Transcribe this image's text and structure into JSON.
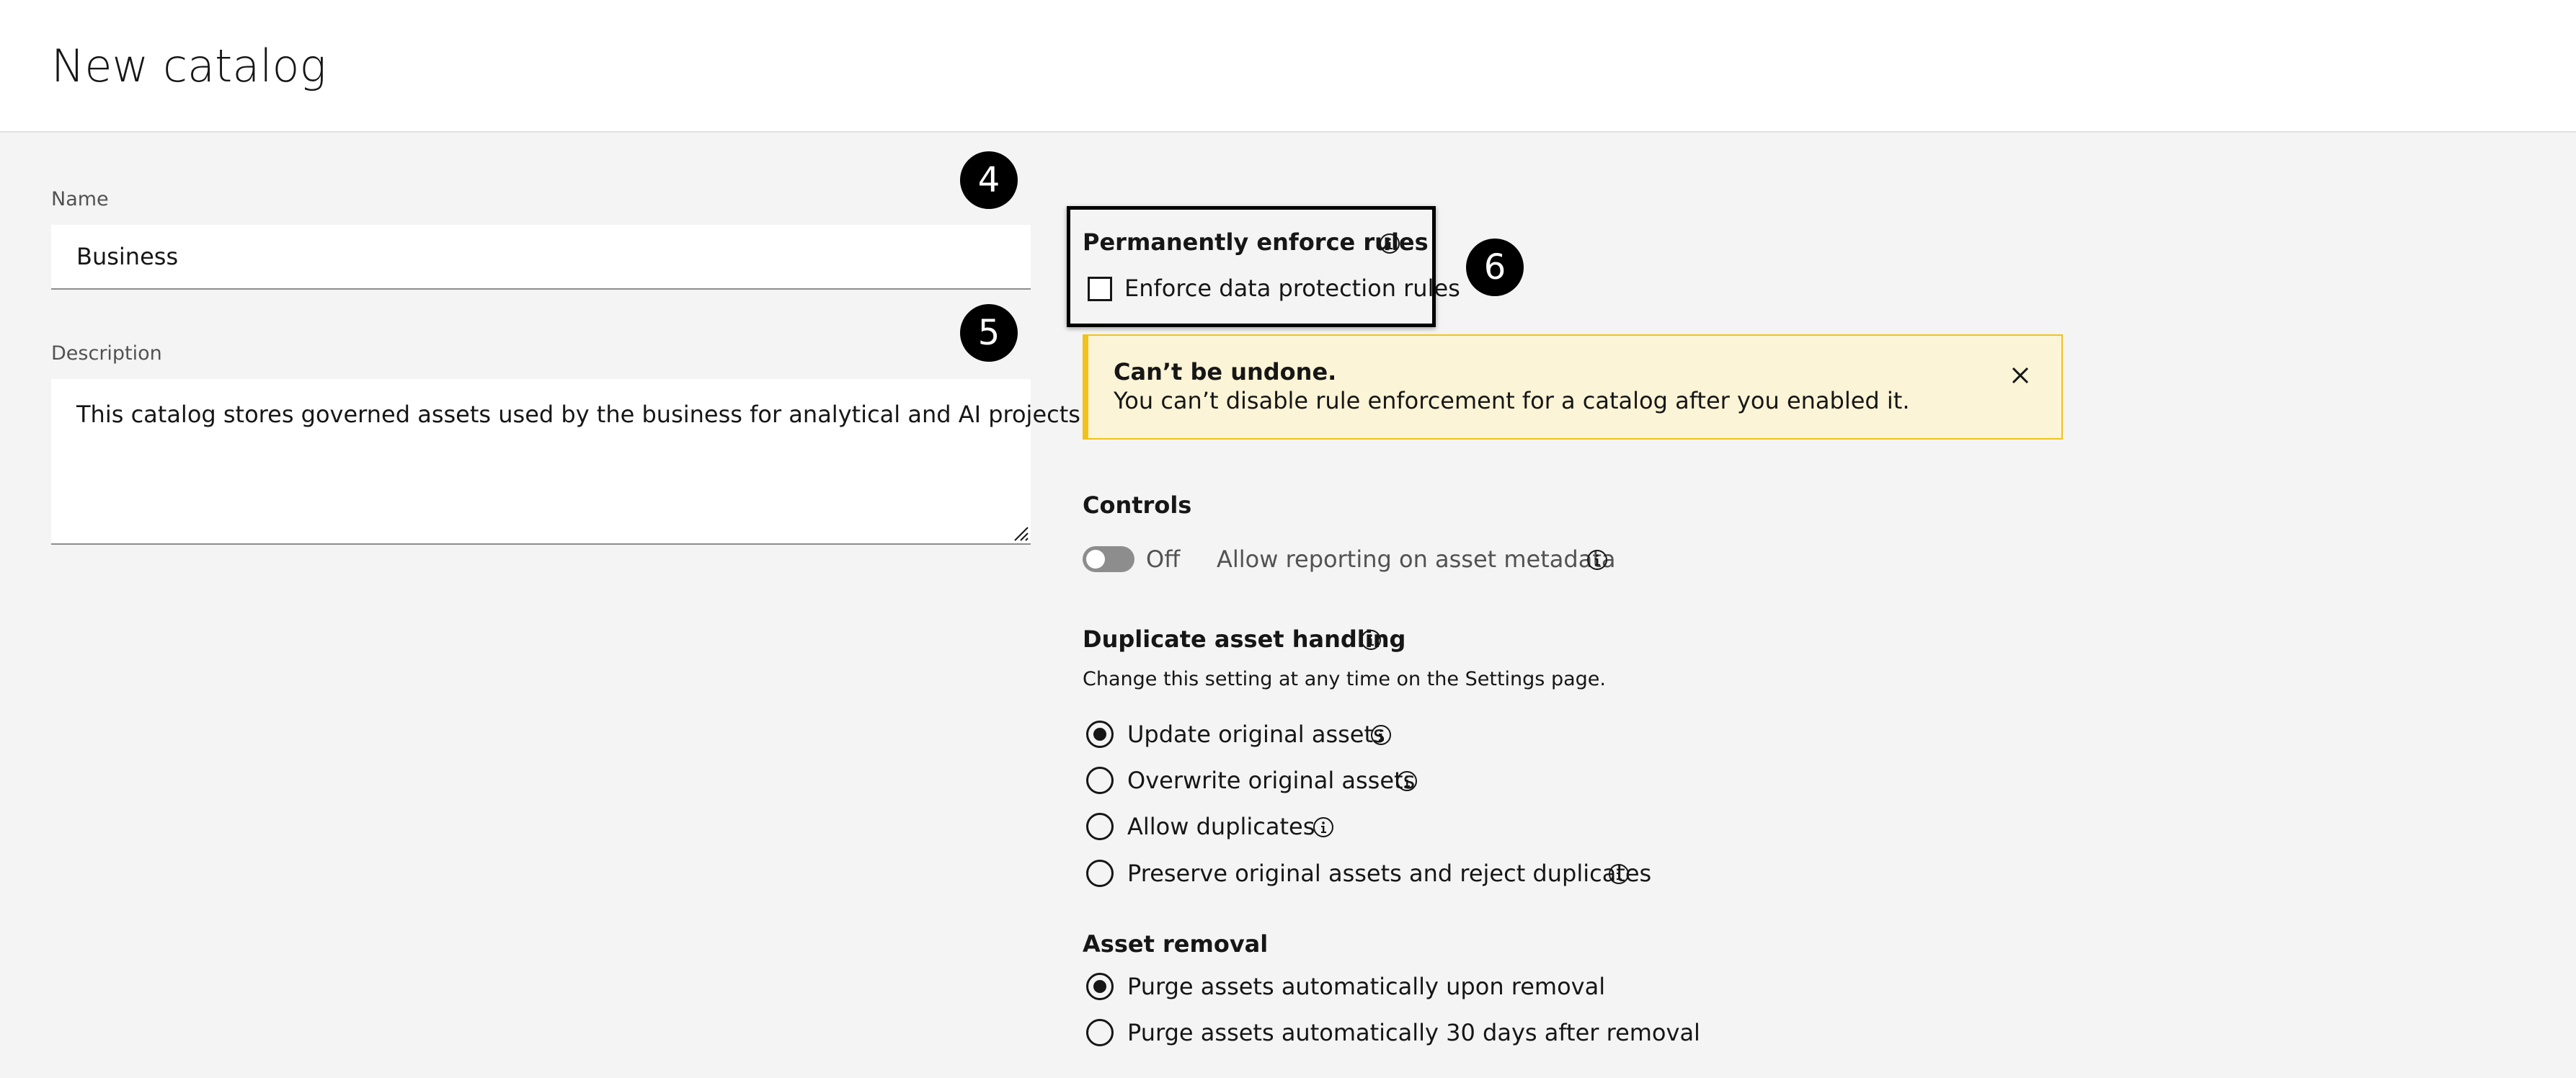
{
  "page": {
    "title": "New catalog"
  },
  "form": {
    "name_label": "Name",
    "name_value": "Business",
    "description_label": "Description",
    "description_value": "This catalog stores governed assets used by the business for analytical and AI projects."
  },
  "badges": [
    "4",
    "5",
    "6"
  ],
  "enforce": {
    "title": "Permanently enforce rules",
    "checkbox_label": "Enforce data protection rules",
    "checked": false
  },
  "notice": {
    "title": "Can’t be undone.",
    "body": "You can’t disable rule enforcement for a catalog after you enabled it."
  },
  "controls": {
    "title": "Controls",
    "toggle_state": "Off",
    "toggle_label": "Allow reporting on asset metadata"
  },
  "duplicate": {
    "title": "Duplicate asset handling",
    "helper": "Change this setting at any time on the Settings page.",
    "options": [
      {
        "label": "Update original assets",
        "selected": true
      },
      {
        "label": "Overwrite original assets",
        "selected": false
      },
      {
        "label": "Allow duplicates",
        "selected": false
      },
      {
        "label": "Preserve original assets and reject duplicates",
        "selected": false
      }
    ]
  },
  "removal": {
    "title": "Asset removal",
    "options": [
      {
        "label": "Purge assets automatically upon removal",
        "selected": true
      },
      {
        "label": "Purge assets automatically 30 days after removal",
        "selected": false
      }
    ]
  },
  "icons": {
    "info": "info-icon",
    "close": "close-icon",
    "resize": "resize-handle-icon"
  },
  "colors": {
    "notice_bg": "#fcf4d6",
    "notice_accent": "#f1c21b",
    "toggle_off": "#8d8d8d"
  }
}
